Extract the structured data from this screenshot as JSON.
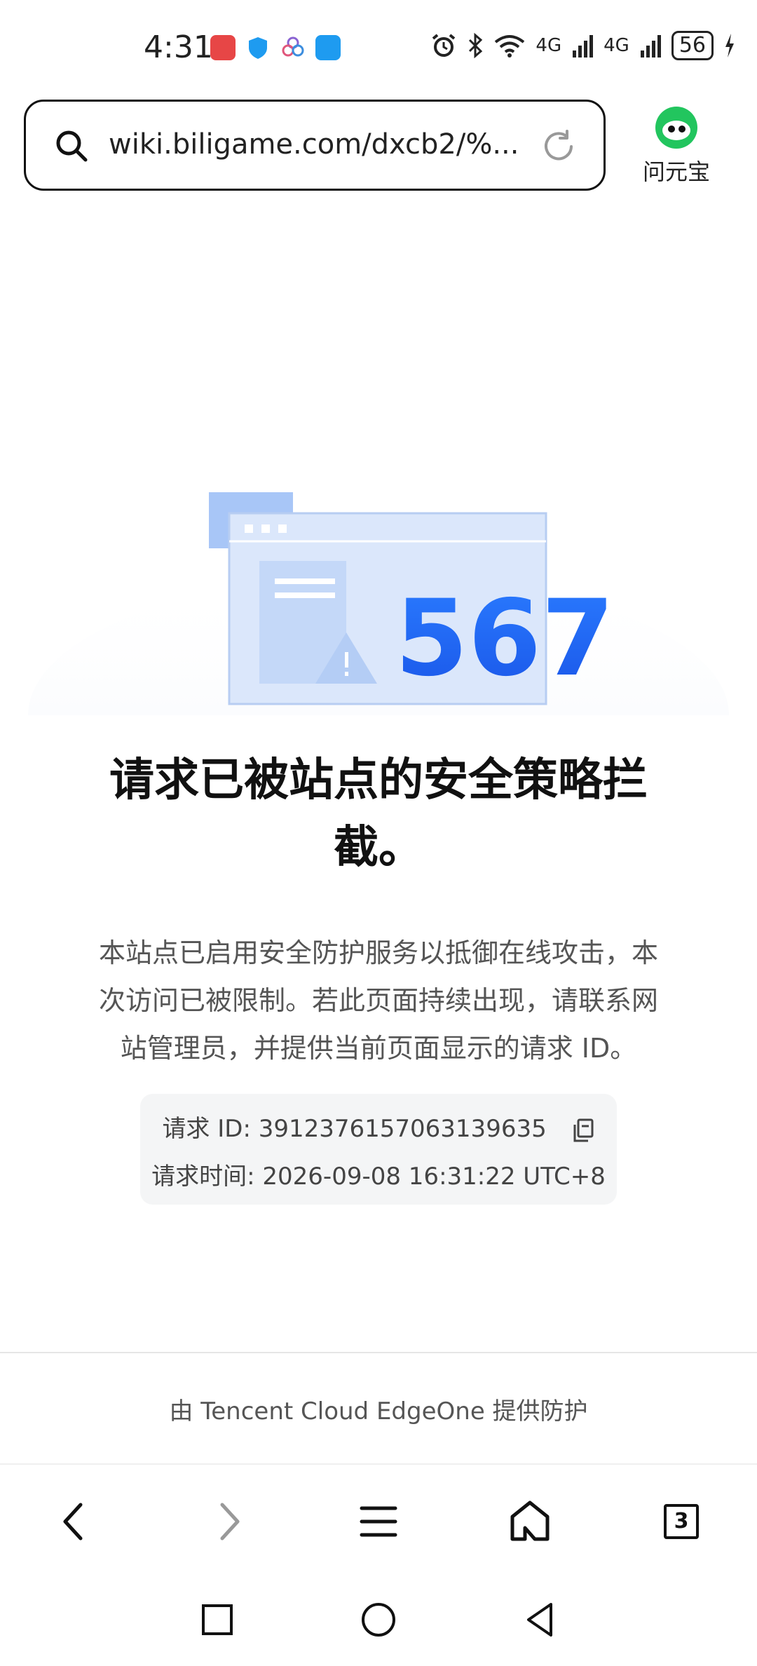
{
  "status_bar": {
    "time": "4:31",
    "signal_1": "4G",
    "signal_2": "4G",
    "battery": "56",
    "icons": [
      "huawei-app-icon",
      "shield-app-icon",
      "flower-app-icon",
      "message-app-icon",
      "alarm-icon",
      "bluetooth-icon",
      "wifi-icon",
      "signal-icon",
      "charging-icon"
    ]
  },
  "address_bar": {
    "url": "wiki.biligame.com/dxcb2/%..."
  },
  "assistant": {
    "label": "问元宝",
    "color": "#1db954"
  },
  "illustration": {
    "code": "567"
  },
  "error": {
    "headline_line1": "请求已被站点的安全策略拦",
    "headline_line2": "截。",
    "description_line1": "本站点已启用安全防护服务以抵御在线攻击，本",
    "description_line2": "次访问已被限制。若此页面持续出现，请联系网",
    "description_line3": "站管理员，并提供当前页面显示的请求 ID。",
    "request_id": "请求 ID: 3912376157063139635",
    "request_time": "请求时间: 2026-09-08 16:31:22 UTC+8"
  },
  "footer": {
    "powered_by": "由 Tencent Cloud EdgeOne 提供防护"
  },
  "toolbar": {
    "tab_count": "3"
  },
  "colors": {
    "accent_blue": "#1f6bf5",
    "illustration_light": "#d8e6fb"
  }
}
